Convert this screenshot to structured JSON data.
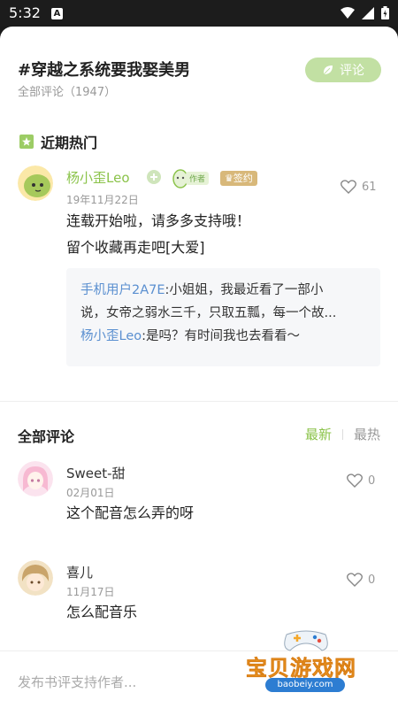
{
  "status_bar": {
    "time": "5:32",
    "notif_glyph": "A"
  },
  "header": {
    "title": "#穿越之系统要我娶美男",
    "subtitle": "全部评论（1947）",
    "comment_button": "评论"
  },
  "hot": {
    "heading": "近期热门",
    "comment": {
      "name": "杨小歪Leo",
      "author_tag": "作者",
      "sign_tag": "签约",
      "date": "19年11月22日",
      "likes": "61",
      "lines": [
        "连载开始啦，请多多支持哦！",
        "留个收藏再走吧[大爱]"
      ],
      "replies": [
        {
          "user": "手机用户2A7E",
          "text": ":小姐姐，我最近看了一部小",
          "text2": "说，女帝之弱水三千，只取五瓢，每一个故..."
        },
        {
          "user": "杨小歪Leo",
          "text": ":是吗？有时间我也去看看～"
        }
      ]
    }
  },
  "all": {
    "heading": "全部评论",
    "sort_new": "最新",
    "sort_hot": "最热",
    "comments": [
      {
        "name": "Sweet-甜",
        "date": "02月01日",
        "text": "这个配音怎么弄的呀",
        "likes": "0"
      },
      {
        "name": "喜儿",
        "date": "11月17日",
        "text": "怎么配音乐",
        "likes": "0"
      }
    ]
  },
  "input": {
    "placeholder": "发布书评支持作者..."
  },
  "watermark": {
    "text": "宝贝游戏网",
    "url": "baobeiy.com"
  },
  "colors": {
    "accent_green": "#8bc34a",
    "reply_user_blue": "#5a8fd0",
    "button_green": "#c2e0a3"
  }
}
